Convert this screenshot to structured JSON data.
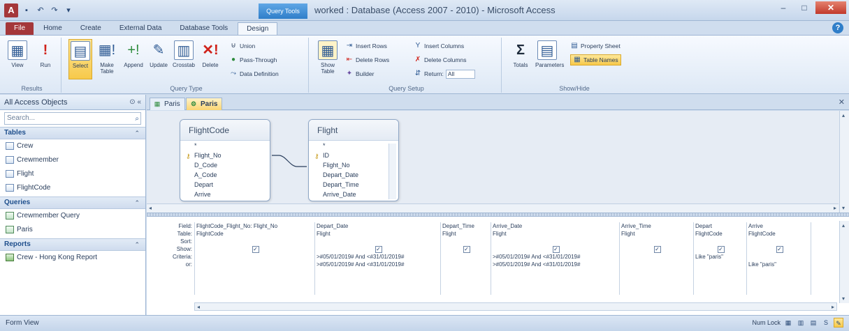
{
  "window": {
    "title": "worked : Database (Access 2007 - 2010) - Microsoft Access",
    "context_tab_title": "Query Tools",
    "app_icon": "A",
    "minimize": "–",
    "maximize": "□",
    "close": "✕"
  },
  "ribbon": {
    "tabs": [
      "File",
      "Home",
      "Create",
      "External Data",
      "Database Tools",
      "Design"
    ],
    "groups": {
      "results": {
        "label": "Results",
        "view": "View",
        "run": "Run"
      },
      "query_type": {
        "label": "Query Type",
        "select": "Select",
        "make_table": "Make Table",
        "append": "Append",
        "update": "Update",
        "crosstab": "Crosstab",
        "delete": "Delete",
        "union": "Union",
        "pass_through": "Pass-Through",
        "data_definition": "Data Definition"
      },
      "query_setup": {
        "label": "Query Setup",
        "show_table": "Show Table",
        "insert_rows": "Insert Rows",
        "delete_rows": "Delete Rows",
        "builder": "Builder",
        "insert_columns": "Insert Columns",
        "delete_columns": "Delete Columns",
        "return": "Return:",
        "return_value": "All"
      },
      "show_hide": {
        "label": "Show/Hide",
        "totals": "Totals",
        "parameters": "Parameters",
        "property_sheet": "Property Sheet",
        "table_names": "Table Names"
      }
    }
  },
  "nav": {
    "header": "All Access Objects",
    "search_placeholder": "Search...",
    "groups": [
      {
        "label": "Tables",
        "items": [
          "Crew",
          "Crewmember",
          "Flight",
          "FlightCode"
        ]
      },
      {
        "label": "Queries",
        "items": [
          "Crewmember Query",
          "Paris"
        ]
      },
      {
        "label": "Reports",
        "items": [
          "Crew - Hong Kong Report"
        ]
      }
    ]
  },
  "doc_tabs": [
    "Paris",
    "Paris"
  ],
  "design": {
    "tables": [
      {
        "name": "FlightCode",
        "fields": [
          "*",
          "Flight_No",
          "D_Code",
          "A_Code",
          "Depart",
          "Arrive"
        ]
      },
      {
        "name": "Flight",
        "fields": [
          "*",
          "ID",
          "Flight_No",
          "Depart_Date",
          "Depart_Time",
          "Arrive_Date"
        ]
      }
    ]
  },
  "grid": {
    "row_labels": [
      "Field:",
      "Table:",
      "Sort:",
      "Show:",
      "Criteria:",
      "or:"
    ],
    "columns": [
      {
        "field": "FlightCode_Flight_No: Flight_No",
        "table": "FlightCode",
        "sort": "",
        "show": true,
        "criteria": "",
        "or": ""
      },
      {
        "field": "Depart_Date",
        "table": "Flight",
        "sort": "",
        "show": true,
        "criteria": ">#05/01/2019# And <#31/01/2019#",
        "or": ">#05/01/2019# And <#31/01/2019#"
      },
      {
        "field": "Depart_Time",
        "table": "Flight",
        "sort": "",
        "show": true,
        "criteria": "",
        "or": ""
      },
      {
        "field": "Arrive_Date",
        "table": "Flight",
        "sort": "",
        "show": true,
        "criteria": ">#05/01/2019# And <#31/01/2019#",
        "or": ">#05/01/2019# And <#31/01/2019#"
      },
      {
        "field": "Arrive_Time",
        "table": "Flight",
        "sort": "",
        "show": true,
        "criteria": "",
        "or": ""
      },
      {
        "field": "Depart",
        "table": "FlightCode",
        "sort": "",
        "show": true,
        "criteria": "Like \"paris\"",
        "or": ""
      },
      {
        "field": "Arrive",
        "table": "FlightCode",
        "sort": "",
        "show": true,
        "criteria": "",
        "or": "Like \"paris\""
      }
    ]
  },
  "status": {
    "left": "Form View",
    "num_lock": "Num Lock"
  }
}
